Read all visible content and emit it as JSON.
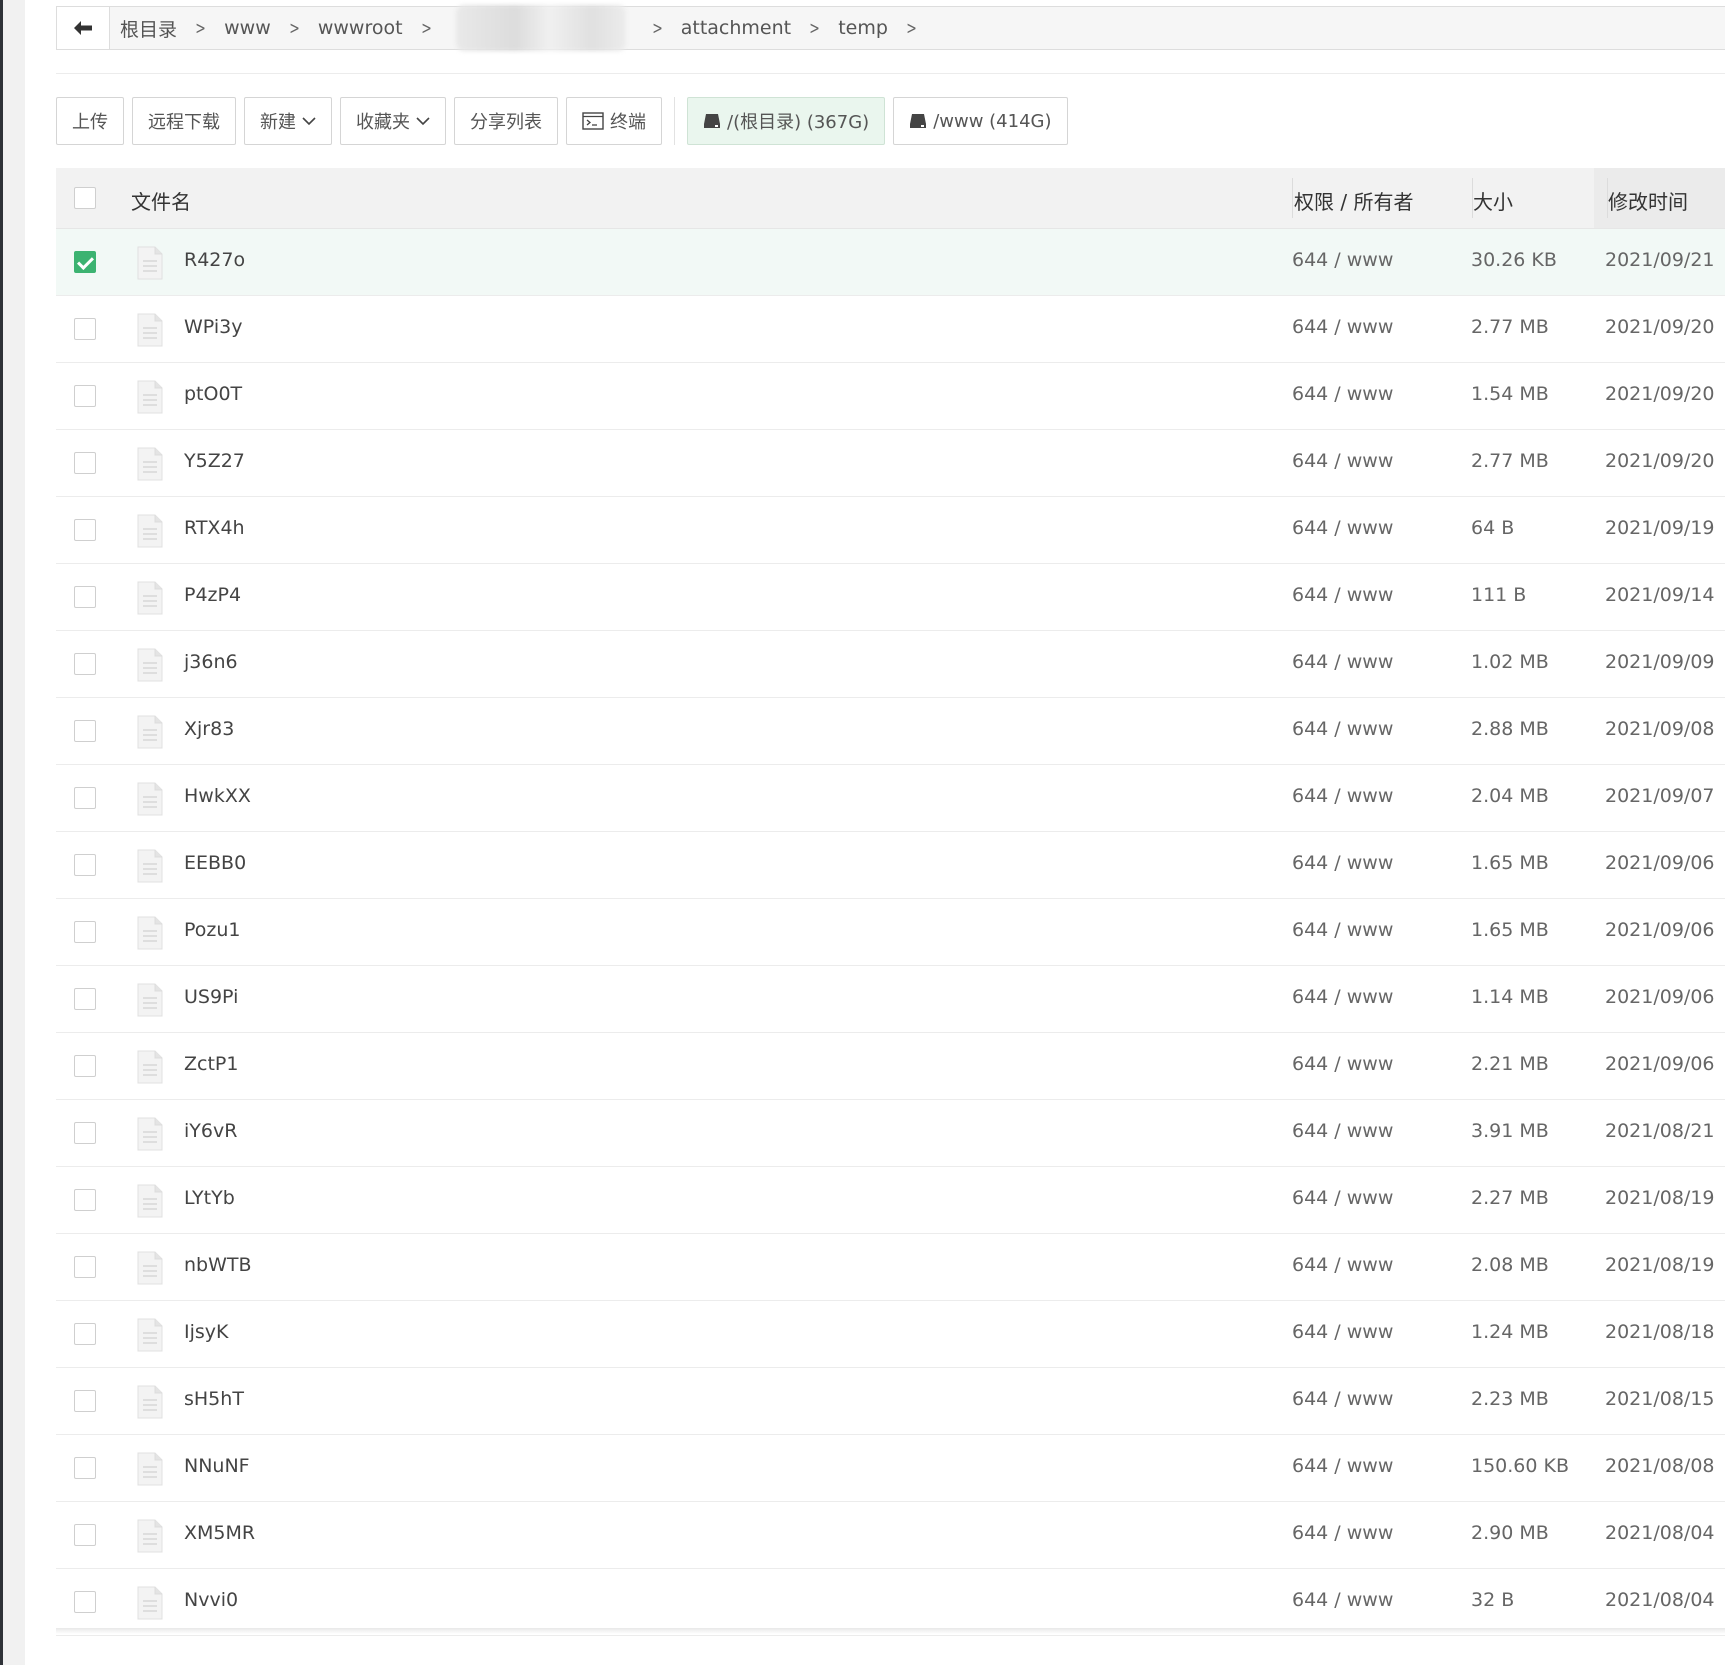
{
  "breadcrumb": {
    "items": [
      "根目录",
      "www",
      "wwwroot",
      "attachment",
      "temp"
    ]
  },
  "toolbar": {
    "upload": "上传",
    "remote_download": "远程下载",
    "new": "新建",
    "favorites": "收藏夹",
    "share_list": "分享列表",
    "terminal": "终端",
    "disk_root": "/(根目录) (367G)",
    "disk_www": "/www (414G)"
  },
  "table": {
    "headers": {
      "name": "文件名",
      "perm": "权限 / 所有者",
      "size": "大小",
      "mtime": "修改时间"
    },
    "rows": [
      {
        "name": "R427o",
        "perm": "644 / www",
        "size": "30.26 KB",
        "date": "2021/09/21",
        "checked": true
      },
      {
        "name": "WPi3y",
        "perm": "644 / www",
        "size": "2.77 MB",
        "date": "2021/09/20",
        "checked": false
      },
      {
        "name": "ptO0T",
        "perm": "644 / www",
        "size": "1.54 MB",
        "date": "2021/09/20",
        "checked": false
      },
      {
        "name": "Y5Z27",
        "perm": "644 / www",
        "size": "2.77 MB",
        "date": "2021/09/20",
        "checked": false
      },
      {
        "name": "RTX4h",
        "perm": "644 / www",
        "size": "64 B",
        "date": "2021/09/19",
        "checked": false
      },
      {
        "name": "P4zP4",
        "perm": "644 / www",
        "size": "111 B",
        "date": "2021/09/14",
        "checked": false
      },
      {
        "name": "j36n6",
        "perm": "644 / www",
        "size": "1.02 MB",
        "date": "2021/09/09",
        "checked": false
      },
      {
        "name": "Xjr83",
        "perm": "644 / www",
        "size": "2.88 MB",
        "date": "2021/09/08",
        "checked": false
      },
      {
        "name": "HwkXX",
        "perm": "644 / www",
        "size": "2.04 MB",
        "date": "2021/09/07",
        "checked": false
      },
      {
        "name": "EEBB0",
        "perm": "644 / www",
        "size": "1.65 MB",
        "date": "2021/09/06",
        "checked": false
      },
      {
        "name": "Pozu1",
        "perm": "644 / www",
        "size": "1.65 MB",
        "date": "2021/09/06",
        "checked": false
      },
      {
        "name": "US9Pi",
        "perm": "644 / www",
        "size": "1.14 MB",
        "date": "2021/09/06",
        "checked": false
      },
      {
        "name": "ZctP1",
        "perm": "644 / www",
        "size": "2.21 MB",
        "date": "2021/09/06",
        "checked": false
      },
      {
        "name": "iY6vR",
        "perm": "644 / www",
        "size": "3.91 MB",
        "date": "2021/08/21",
        "checked": false
      },
      {
        "name": "LYtYb",
        "perm": "644 / www",
        "size": "2.27 MB",
        "date": "2021/08/19",
        "checked": false
      },
      {
        "name": "nbWTB",
        "perm": "644 / www",
        "size": "2.08 MB",
        "date": "2021/08/19",
        "checked": false
      },
      {
        "name": "IjsyK",
        "perm": "644 / www",
        "size": "1.24 MB",
        "date": "2021/08/18",
        "checked": false
      },
      {
        "name": "sH5hT",
        "perm": "644 / www",
        "size": "2.23 MB",
        "date": "2021/08/15",
        "checked": false
      },
      {
        "name": "NNuNF",
        "perm": "644 / www",
        "size": "150.60 KB",
        "date": "2021/08/08",
        "checked": false
      },
      {
        "name": "XM5MR",
        "perm": "644 / www",
        "size": "2.90 MB",
        "date": "2021/08/04",
        "checked": false
      },
      {
        "name": "Nvvi0",
        "perm": "644 / www",
        "size": "32 B",
        "date": "2021/08/04",
        "checked": false
      }
    ]
  },
  "colors": {
    "accent_green": "#3cb371",
    "selected_row_bg": "#f2f9f6",
    "header_bg": "#f2f2f2"
  }
}
